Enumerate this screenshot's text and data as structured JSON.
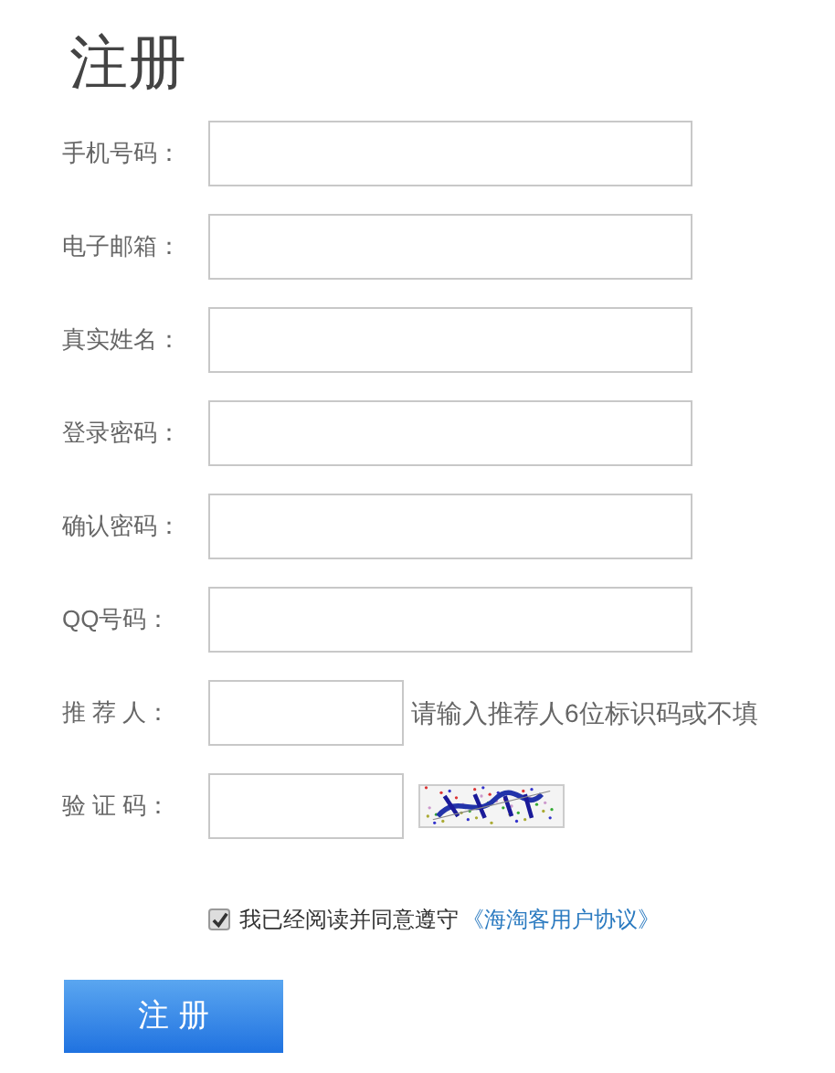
{
  "title": "注册",
  "fields": [
    {
      "kind": "wide",
      "label": "手机号码："
    },
    {
      "kind": "wide",
      "label": "电子邮箱："
    },
    {
      "kind": "wide",
      "label": "真实姓名："
    },
    {
      "kind": "wide",
      "label": "登录密码："
    },
    {
      "kind": "wide",
      "label": "确认密码："
    },
    {
      "kind": "wide",
      "label": "QQ号码："
    },
    {
      "kind": "hint",
      "label": "推 荐 人：",
      "hint": "请输入推荐人6位标识码或不填"
    },
    {
      "kind": "captcha",
      "label": "验 证 码："
    }
  ],
  "agreement": {
    "checked": true,
    "text": "我已经阅读并同意遵守",
    "link": "《海淘客用户协议》"
  },
  "submit": "注 册"
}
